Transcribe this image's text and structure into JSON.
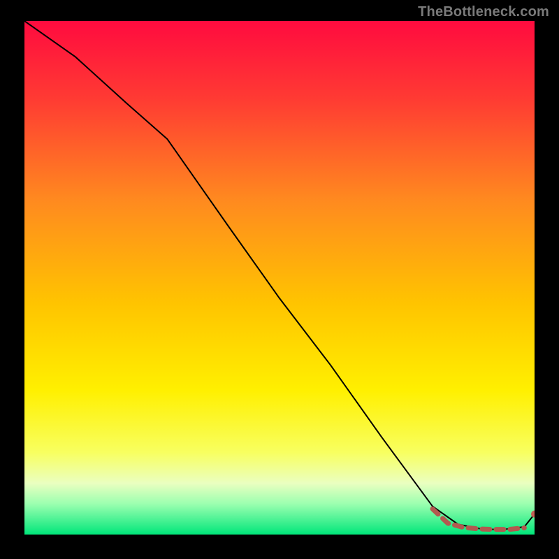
{
  "attribution": "TheBottleneck.com",
  "colors": {
    "background": "#000000",
    "gradient_stops": [
      {
        "offset": 0.0,
        "color": "#ff0b3f"
      },
      {
        "offset": 0.15,
        "color": "#ff3a33"
      },
      {
        "offset": 0.35,
        "color": "#ff8a1f"
      },
      {
        "offset": 0.55,
        "color": "#ffc400"
      },
      {
        "offset": 0.72,
        "color": "#fff000"
      },
      {
        "offset": 0.84,
        "color": "#f8ff60"
      },
      {
        "offset": 0.9,
        "color": "#eaffc0"
      },
      {
        "offset": 0.94,
        "color": "#9cffb0"
      },
      {
        "offset": 1.0,
        "color": "#00e67a"
      }
    ],
    "curve": "#000000",
    "dashed_segment": "#b2594f",
    "point": "#c66056"
  },
  "chart_data": {
    "type": "line",
    "title": "",
    "xlabel": "",
    "ylabel": "",
    "xlim": [
      0,
      100
    ],
    "ylim": [
      0,
      100
    ],
    "series": [
      {
        "name": "main-curve",
        "style": "solid",
        "x": [
          0,
          10,
          20,
          28,
          40,
          50,
          60,
          70,
          80,
          85,
          90,
          94,
          98,
          100
        ],
        "y": [
          100,
          93,
          84,
          77,
          60,
          46,
          33,
          19,
          5.5,
          2,
          1,
          1,
          1.5,
          4
        ]
      },
      {
        "name": "dashed-plateau",
        "style": "dashed",
        "x": [
          80,
          83,
          86,
          89,
          92,
          95,
          98
        ],
        "y": [
          5,
          2.2,
          1.4,
          1.1,
          1.0,
          1.0,
          1.3
        ]
      }
    ],
    "points": [
      {
        "name": "end-point",
        "x": 100,
        "y": 4
      }
    ]
  }
}
